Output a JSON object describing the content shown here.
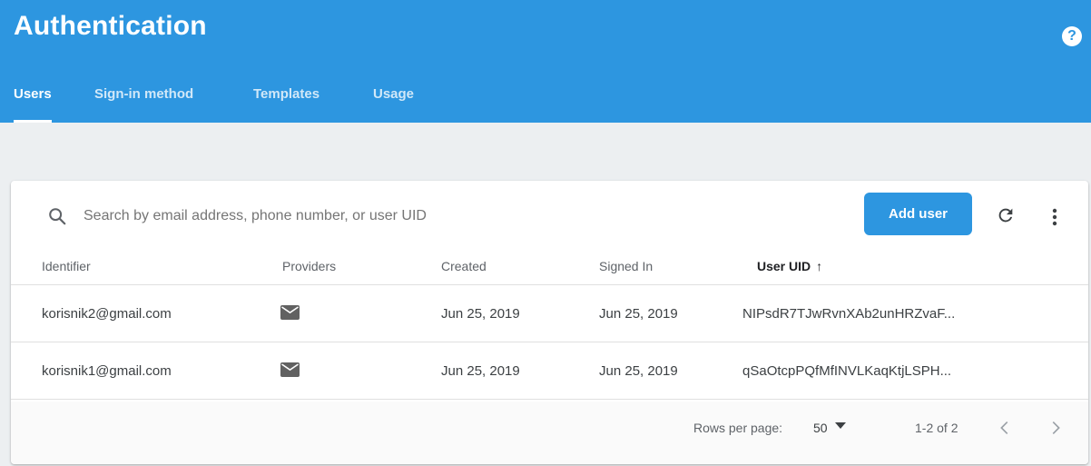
{
  "header": {
    "title": "Authentication",
    "help_icon": "help-icon",
    "help_label": "?",
    "tabs": [
      {
        "label": "Users",
        "active": true
      },
      {
        "label": "Sign-in method",
        "active": false
      },
      {
        "label": "Templates",
        "active": false
      },
      {
        "label": "Usage",
        "active": false
      }
    ],
    "accent_color": "#2d96e0"
  },
  "search": {
    "placeholder": "Search by email address, phone number, or user UID",
    "value": "",
    "icon": "search-icon"
  },
  "toolbar": {
    "add_user_label": "Add user",
    "refresh_icon": "refresh-icon",
    "more_icon": "more-vert-icon"
  },
  "table": {
    "columns": {
      "identifier": "Identifier",
      "providers": "Providers",
      "created": "Created",
      "signed_in": "Signed In",
      "user_uid": "User UID",
      "sort_indicator": "↑"
    },
    "rows": [
      {
        "identifier": "korisnik2@gmail.com",
        "provider_icon": "email-icon",
        "created": "Jun 25, 2019",
        "signed_in": "Jun 25, 2019",
        "user_uid": "NIPsdR7TJwRvnXAb2unHRZvaF..."
      },
      {
        "identifier": "korisnik1@gmail.com",
        "provider_icon": "email-icon",
        "created": "Jun 25, 2019",
        "signed_in": "Jun 25, 2019",
        "user_uid": "qSaOtcpPQfMfINVLKaqKtjLSPH..."
      }
    ]
  },
  "pagination": {
    "rows_per_page_label": "Rows per page:",
    "rows_per_page_value": "50",
    "range": "1-2 of 2",
    "prev_icon": "chevron-left-icon",
    "next_icon": "chevron-right-icon"
  }
}
